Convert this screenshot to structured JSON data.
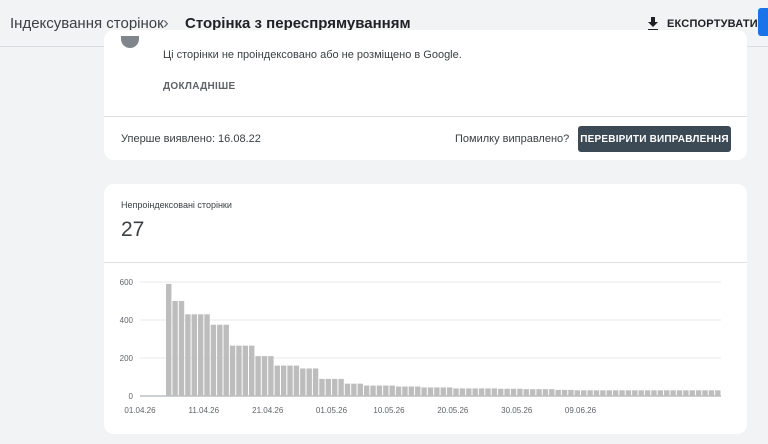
{
  "header": {
    "breadcrumb_parent": "Індексування сторінок",
    "breadcrumb_separator": "›",
    "breadcrumb_current": "Сторінка з переспрямуванням",
    "export_label": "ЕКСПОРТУВАТИ",
    "export_icon": "download-icon"
  },
  "issue": {
    "description": "Ці сторінки не проіндексовано або не розміщено в Google.",
    "learn_more": "ДОКЛАДНІШЕ",
    "first_detected": "Уперше виявлено: 16.08.22",
    "fixed_question": "Помилку виправлено?",
    "validate_button": "ПЕРЕВІРИТИ ВИПРАВЛЕННЯ"
  },
  "metric": {
    "label": "Непроіндексовані сторінки",
    "value": "27"
  },
  "colors": {
    "bar": "#bdbdbd",
    "button": "#3c4a55",
    "accent": "#1a73e8"
  },
  "chart_data": {
    "type": "bar",
    "ylim": [
      0,
      600
    ],
    "y_ticks": [
      "600",
      "400",
      "200",
      "0"
    ],
    "x_tick_labels": [
      "01.04.26",
      "11.04.26",
      "21.04.26",
      "01.05.26",
      "10.05.26",
      "20.05.26",
      "30.05.26",
      "09.06.26"
    ],
    "values": [
      0,
      0,
      0,
      0,
      590,
      500,
      500,
      430,
      430,
      430,
      430,
      375,
      375,
      375,
      265,
      265,
      265,
      265,
      210,
      210,
      210,
      160,
      160,
      160,
      160,
      145,
      145,
      145,
      90,
      90,
      90,
      90,
      65,
      65,
      65,
      55,
      55,
      55,
      55,
      55,
      50,
      50,
      50,
      50,
      45,
      45,
      45,
      45,
      45,
      40,
      40,
      40,
      40,
      40,
      40,
      40,
      38,
      38,
      38,
      38,
      36,
      36,
      36,
      36,
      36,
      32,
      32,
      32,
      30,
      30,
      30,
      30,
      30,
      30,
      30,
      30,
      30,
      30,
      30,
      30,
      30,
      30,
      30,
      30,
      30,
      30,
      30,
      30,
      30,
      30,
      30
    ]
  }
}
